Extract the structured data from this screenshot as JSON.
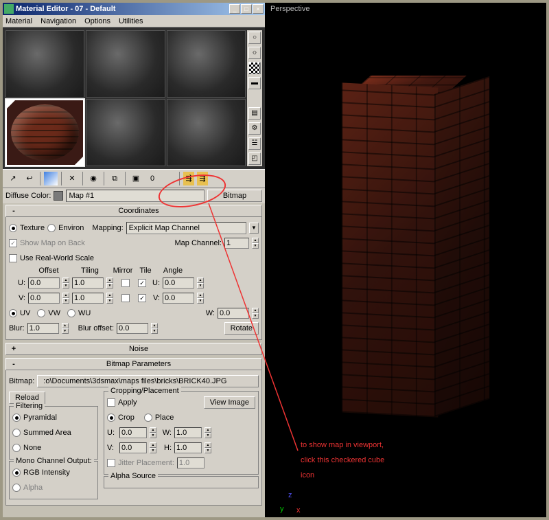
{
  "window": {
    "title": "Material Editor - 07 - Default"
  },
  "winbtns": {
    "min": "_",
    "max": "□",
    "close": "×"
  },
  "menu": {
    "material": "Material",
    "navigation": "Navigation",
    "options": "Options",
    "utilities": "Utilities"
  },
  "sideIcons": {
    "sample": "○",
    "back": "□",
    "checker": "▦",
    "light": "☼",
    "uv": "▬",
    "vid": "▤",
    "opt": "⚙",
    "preset": "☱",
    "cube": "◰"
  },
  "toolbar": {
    "pick": "↗",
    "back": "↩",
    "assign": "⬛",
    "sep": "|",
    "del": "✕",
    "sep2": "|",
    "make": "◉",
    "sep3": "|",
    "clone": "⧉",
    "sep4": "|",
    "put": "▣",
    "show0": "0",
    "showmap": "▦",
    "go": "⇶"
  },
  "mapRow": {
    "label": "Diffuse Color:",
    "swatch": "",
    "mapname": "Map #1",
    "btn": "Bitmap"
  },
  "rollups": {
    "coords": {
      "title": "Coordinates",
      "pm": "-"
    },
    "noise": {
      "title": "Noise",
      "pm": "+"
    },
    "bparams": {
      "title": "Bitmap Parameters",
      "pm": "-"
    }
  },
  "coords": {
    "texture": "Texture",
    "environ": "Environ",
    "mapping": "Mapping:",
    "mapChannelDD": "Explicit Map Channel",
    "showMap": "Show Map on Back",
    "mapChannel": "Map Channel:",
    "mapChVal": "1",
    "realWorld": "Use Real-World Scale",
    "offset": "Offset",
    "tiling": "Tiling",
    "mirror": "Mirror",
    "tile": "Tile",
    "angle": "Angle",
    "u": "U:",
    "v": "V:",
    "w": "W:",
    "u_off": "0.0",
    "u_til": "1.0",
    "u_ang": "0.0",
    "v_off": "0.0",
    "v_til": "1.0",
    "v_ang": "0.0",
    "w_ang": "0.0",
    "uv": "UV",
    "vw": "VW",
    "wu": "WU",
    "blur": "Blur:",
    "blurVal": "1.0",
    "blurOff": "Blur offset:",
    "blurOffVal": "0.0",
    "rotate": "Rotate"
  },
  "bparams": {
    "bitmap": "Bitmap:",
    "path": ":o\\Documents\\3dsmax\\maps files\\bricks\\BRICK40.JPG",
    "reload": "Reload",
    "cropping": "Cropping/Placement",
    "apply": "Apply",
    "viewimg": "View Image",
    "crop": "Crop",
    "place": "Place",
    "filtering": "Filtering",
    "pyramidal": "Pyramidal",
    "summed": "Summed Area",
    "none": "None",
    "u": "U:",
    "v": "V:",
    "w": "W:",
    "h": "H:",
    "uVal": "0.0",
    "vVal": "0.0",
    "wVal": "1.0",
    "hVal": "1.0",
    "jitter": "Jitter Placement:",
    "jVal": "1.0",
    "mono": "Mono Channel Output:",
    "rgb": "RGB Intensity",
    "alpha": "Alpha",
    "alphasrc": "Alpha Source"
  },
  "viewport": {
    "label": "Perspective"
  },
  "annotation": {
    "l1": "to show map in viewport,",
    "l2": "click this checkered cube",
    "l3": "icon"
  },
  "axis": {
    "x": "x",
    "y": "y",
    "z": "z"
  }
}
